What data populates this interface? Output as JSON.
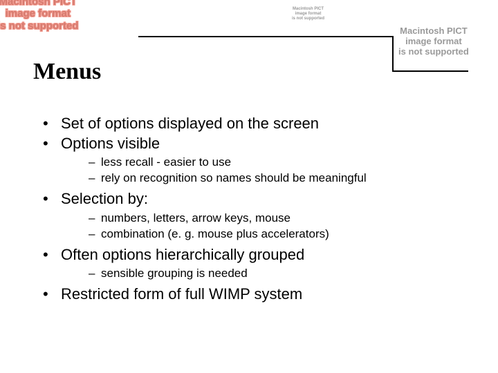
{
  "placeholders": {
    "left": "Macintosh PICT\nimage format\nis not supported",
    "mid": "Macintosh PICT\nimage format\nis not supported",
    "right": "Macintosh PICT\nimage format\nis not supported"
  },
  "title": "Menus",
  "bullets": {
    "b0": "Set of options displayed on the screen",
    "b1": "Options visible",
    "b1s": {
      "s0": "less recall - easier to use",
      "s1": "rely on recognition so names should be meaningful"
    },
    "b2": "Selection by:",
    "b2s": {
      "s0": "numbers, letters, arrow keys, mouse",
      "s1": "combination  (e. g. mouse plus accelerators)"
    },
    "b3": "Often options hierarchically grouped",
    "b3s": {
      "s0": "sensible grouping is needed"
    },
    "b4": "Restricted form of full WIMP system"
  }
}
